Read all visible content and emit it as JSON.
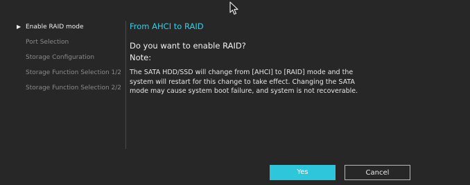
{
  "sidebar": {
    "items": [
      {
        "label": "Enable RAID mode",
        "active": true
      },
      {
        "label": "Port Selection",
        "active": false
      },
      {
        "label": "Storage Configuration",
        "active": false
      },
      {
        "label": "Storage Function Selection 1/2",
        "active": false
      },
      {
        "label": "Storage Function Selection 2/2",
        "active": false
      }
    ]
  },
  "dialog": {
    "title": "From AHCI to RAID",
    "question": "Do you want to enable RAID?",
    "note_label": "Note:",
    "description": "The SATA HDD/SSD will change from [AHCI] to [RAID] mode and the system will restart for this change to take effect. Changing the SATA mode may cause system boot failure, and system is not recoverable."
  },
  "buttons": {
    "yes_label": "Yes",
    "cancel_label": "Cancel"
  },
  "colors": {
    "accent": "#2bd3e8",
    "background": "#272727",
    "yes_button": "#2ec6db"
  },
  "icons": {
    "selected_marker": "triangle-right-icon",
    "pointer": "mouse-cursor-icon"
  }
}
